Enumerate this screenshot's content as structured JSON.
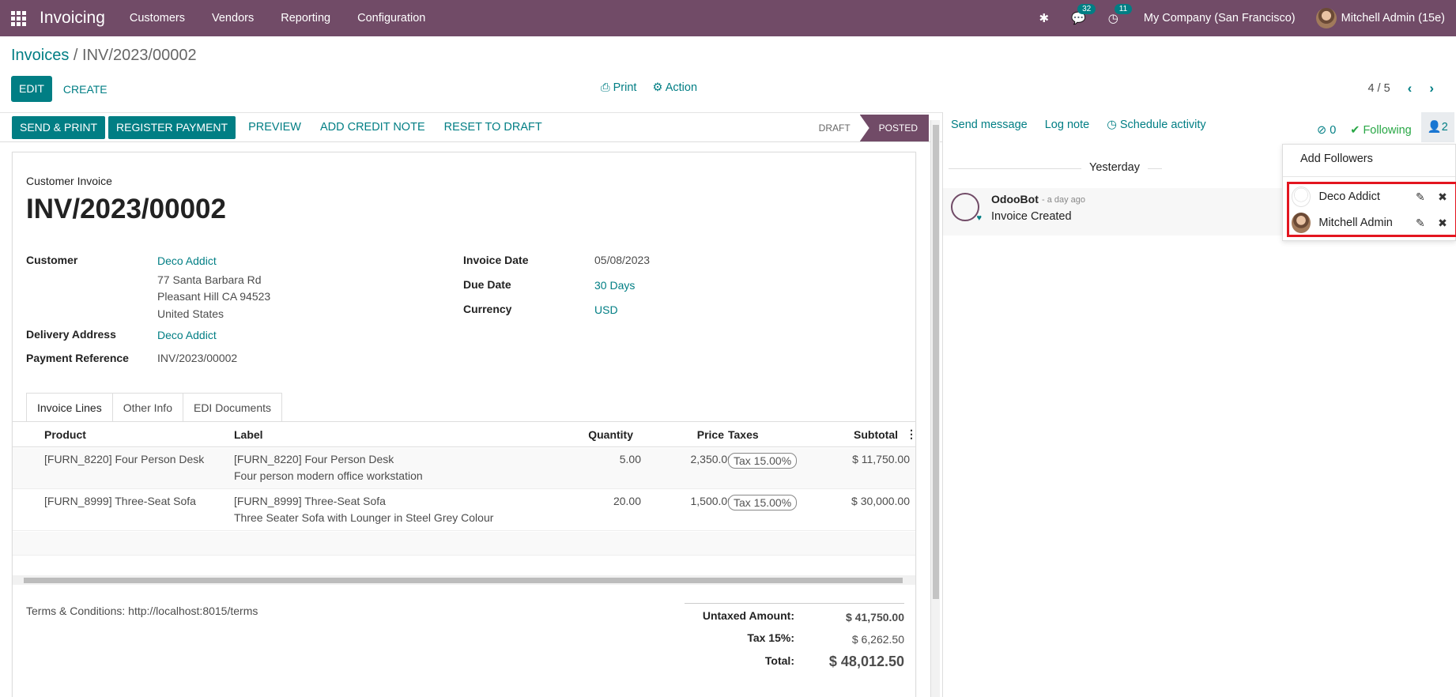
{
  "navbar": {
    "app_name": "Invoicing",
    "menu": [
      "Customers",
      "Vendors",
      "Reporting",
      "Configuration"
    ],
    "messages_count": "32",
    "activities_count": "11",
    "company": "My Company (San Francisco)",
    "user": "Mitchell Admin (15e)",
    "bar_color": "#714b67"
  },
  "breadcrumb": {
    "parent": "Invoices",
    "separator": " / ",
    "current": "INV/2023/00002"
  },
  "controls": {
    "edit": "EDIT",
    "create": "CREATE",
    "print": "Print",
    "action": "Action",
    "pager": "4 / 5"
  },
  "status_bar": {
    "send_print": "SEND & PRINT",
    "register_payment": "REGISTER PAYMENT",
    "preview": "PREVIEW",
    "add_credit_note": "ADD CREDIT NOTE",
    "reset_to_draft": "RESET TO DRAFT",
    "stage_draft": "DRAFT",
    "stage_posted": "POSTED"
  },
  "invoice": {
    "subtitle": "Customer Invoice",
    "number": "INV/2023/00002",
    "customer_label": "Customer",
    "customer_name": "Deco Addict",
    "address_line1": "77 Santa Barbara Rd",
    "address_line2": "Pleasant Hill CA 94523",
    "address_line3": "United States",
    "delivery_label": "Delivery Address",
    "delivery_value": "Deco Addict",
    "payment_ref_label": "Payment Reference",
    "payment_ref_value": "INV/2023/00002",
    "invoice_date_label": "Invoice Date",
    "invoice_date": "05/08/2023",
    "due_date_label": "Due Date",
    "due_date": "30 Days",
    "currency_label": "Currency",
    "currency": "USD"
  },
  "tabs": [
    "Invoice Lines",
    "Other Info",
    "EDI Documents"
  ],
  "table": {
    "columns": [
      "Product",
      "Label",
      "Quantity",
      "Price",
      "Taxes",
      "Subtotal"
    ],
    "rows": [
      {
        "product": "[FURN_8220] Four Person Desk",
        "label1": "[FURN_8220] Four Person Desk",
        "label2": "Four person modern office workstation",
        "quantity": "5.00",
        "price": "2,350.00",
        "tax": "Tax 15.00%",
        "subtotal": "$ 11,750.00"
      },
      {
        "product": "[FURN_8999] Three-Seat Sofa",
        "label1": "[FURN_8999] Three-Seat Sofa",
        "label2": "Three Seater Sofa with Lounger in Steel Grey Colour",
        "quantity": "20.00",
        "price": "1,500.00",
        "tax": "Tax 15.00%",
        "subtotal": "$ 30,000.00"
      }
    ]
  },
  "terms": "Terms & Conditions: http://localhost:8015/terms",
  "totals": {
    "untaxed_label": "Untaxed Amount:",
    "untaxed_value": "$ 41,750.00",
    "tax_label": "Tax 15%:",
    "tax_value": "$ 6,262.50",
    "total_label": "Total:",
    "total_value": "$ 48,012.50"
  },
  "chatter": {
    "send_message": "Send message",
    "log_note": "Log note",
    "schedule_activity": "Schedule activity",
    "attachments_count": "0",
    "following": "Following",
    "followers_count": "2",
    "date_separator": "Yesterday",
    "message_author": "OdooBot",
    "message_time": "- a day ago",
    "message_body": "Invoice Created"
  },
  "followers_dropdown": {
    "add_followers": "Add Followers",
    "followers": [
      "Deco Addict",
      "Mitchell Admin"
    ]
  }
}
